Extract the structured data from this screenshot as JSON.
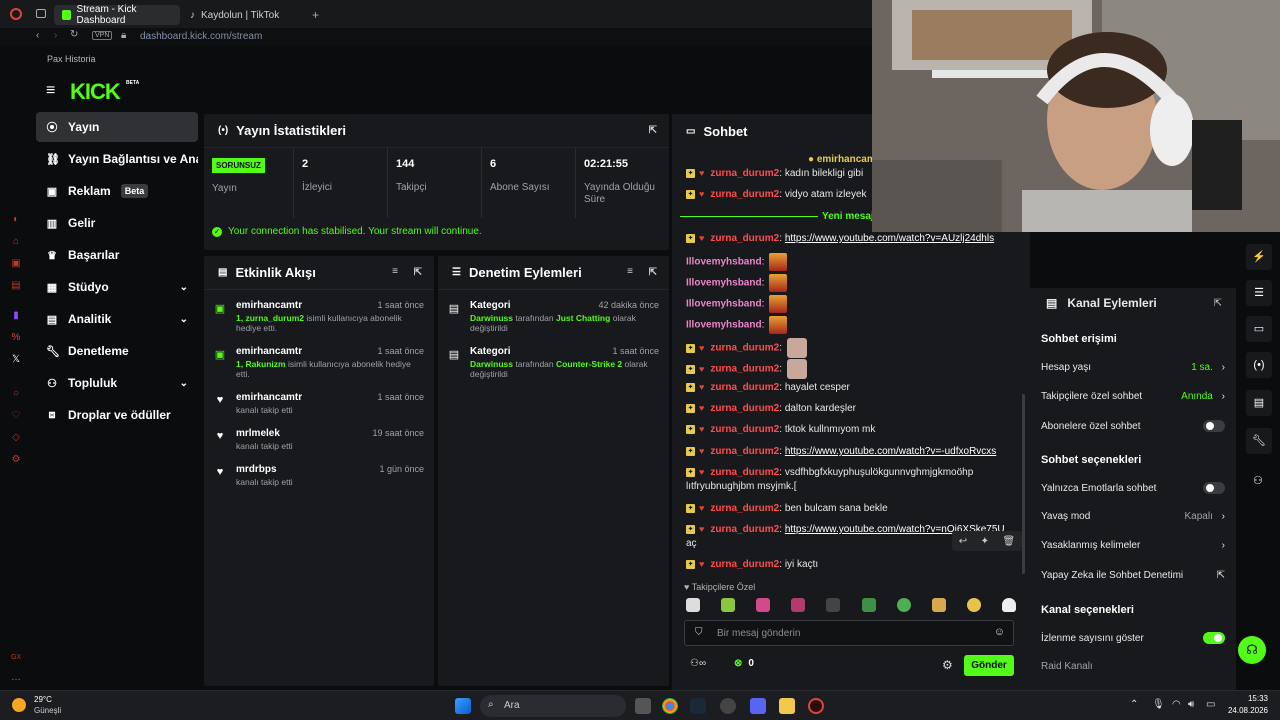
{
  "browser": {
    "tabs": [
      {
        "label": "Stream - Kick Dashboard",
        "active": true
      },
      {
        "label": "Kaydolun | TikTok",
        "active": false
      }
    ],
    "url_domain": "dashboard.kick.com",
    "url_path": "/stream",
    "vpn": "VPN",
    "bookmark": "Pax Historia"
  },
  "kick": {
    "logo": "KICK",
    "logo_sup": "BETA"
  },
  "sidebar": {
    "items": [
      {
        "label": "Yayın",
        "icon": "broadcast-icon",
        "active": true
      },
      {
        "label": "Yayın Bağlantısı ve Anahtar",
        "icon": "link-icon"
      },
      {
        "label": "Reklam",
        "icon": "ad-icon",
        "badge": "Beta"
      },
      {
        "label": "Gelir",
        "icon": "revenue-icon"
      },
      {
        "label": "Başarılar",
        "icon": "trophy-icon"
      },
      {
        "label": "Stüdyo",
        "icon": "studio-icon",
        "expandable": true
      },
      {
        "label": "Analitik",
        "icon": "chart-icon",
        "expandable": true
      },
      {
        "label": "Denetleme",
        "icon": "wrench-icon"
      },
      {
        "label": "Topluluk",
        "icon": "people-icon",
        "expandable": true
      },
      {
        "label": "Droplar ve ödüller",
        "icon": "gift-icon"
      }
    ]
  },
  "stats": {
    "title": "Yayın İstatistikleri",
    "status_badge": "SORUNSUZ",
    "status_label": "Yayın",
    "viewers": "2",
    "viewers_label": "İzleyici",
    "followers": "144",
    "followers_label": "Takipçi",
    "subs": "6",
    "subs_label": "Abone Sayısı",
    "uptime": "02:21:55",
    "uptime_label": "Yayında Olduğu Süre",
    "notice": "Your connection has stabilised. Your stream will continue."
  },
  "activity": {
    "title": "Etkinlik Akışı",
    "rows": [
      {
        "name": "emirhancamtr",
        "time": "1 saat önce",
        "desc_hl": "1, zurna_durum2",
        "desc": " isimli kullanıcıya abonelik hediye etti.",
        "icon": "gift-icon"
      },
      {
        "name": "emirhancamtr",
        "time": "1 saat önce",
        "desc_hl": "1, Rakunizm",
        "desc": " isimli kullanıcıya abonelik hediye etti.",
        "icon": "gift-icon"
      },
      {
        "name": "emirhancamtr",
        "time": "1 saat önce",
        "desc_hl": "",
        "desc": "kanalı takip etti",
        "icon": "heart-icon"
      },
      {
        "name": "mrlmelek",
        "time": "19 saat önce",
        "desc_hl": "",
        "desc": "kanalı takip etti",
        "icon": "heart-icon"
      },
      {
        "name": "mrdrbps",
        "time": "1 gün önce",
        "desc_hl": "",
        "desc": "kanalı takip etti",
        "icon": "heart-icon"
      }
    ]
  },
  "moderation": {
    "title": "Denetim Eylemleri",
    "rows": [
      {
        "name": "Kategori",
        "time": "42 dakika önce",
        "actor": "Darwinuss",
        "mid": " tarafından ",
        "value": "Just Chatting",
        "tail": " olarak değiştirildi"
      },
      {
        "name": "Kategori",
        "time": "1 saat önce",
        "actor": "Darwinuss",
        "mid": " tarafından ",
        "value": "Counter-Strike 2",
        "tail": " olarak değiştirildi"
      }
    ]
  },
  "chat": {
    "title": "Sohbet",
    "pinned_user": "emirhancam",
    "new_messages": "Yeni mesajl",
    "messages": [
      {
        "user": "zurna_durum2",
        "text": "kadın bilekligi gibi"
      },
      {
        "user": "zurna_durum2",
        "text": "vidyo atam izleyek"
      },
      {
        "user": "zurna_durum2",
        "text": "https://www.youtube.com/watch?v=AUzlj24dhls",
        "link": true
      },
      {
        "user": "Illovemyhsband",
        "text": "",
        "emote": "fire"
      },
      {
        "user": "Illovemyhsband",
        "text": "",
        "emote": "fire"
      },
      {
        "user": "Illovemyhsband",
        "text": "",
        "emote": "fire"
      },
      {
        "user": "Illovemyhsband",
        "text": "",
        "emote": "fire"
      },
      {
        "user": "zurna_durum2",
        "text": "",
        "emote": "cat"
      },
      {
        "user": "zurna_durum2",
        "text": "",
        "emote": "cat"
      },
      {
        "user": "zurna_durum2",
        "text": "hayalet cesper"
      },
      {
        "user": "zurna_durum2",
        "text": "dalton kardeşler"
      },
      {
        "user": "zurna_durum2",
        "text": "tktok kullnmıyom mk"
      },
      {
        "user": "zurna_durum2",
        "text": "https://www.youtube.com/watch?v=-udfxoRvcxs",
        "link": true
      },
      {
        "user": "zurna_durum2",
        "text": "vsdfhbgfxkuyphuşulökgunnvghmjgkmoöhp"
      },
      {
        "user": "",
        "text": "lıtfryubnughjbm msyjmk.["
      },
      {
        "user": "zurna_durum2",
        "text": "ben bulcam sana bekle"
      },
      {
        "user": "zurna_durum2",
        "text": "https://www.youtube.com/watch?v=nOi6XSke75U",
        "link": true
      },
      {
        "user": "",
        "text": "aç"
      },
      {
        "user": "zurna_durum2",
        "text": "iyi kaçtı"
      }
    ],
    "followers_only": "Takipçilere Özel",
    "input_placeholder": "Bir mesaj gönderin",
    "points": "0",
    "send": "Gönder"
  },
  "channel_actions": {
    "title": "Kanal Eylemleri",
    "sec1": "Sohbet erişimi",
    "account_age": "Hesap yaşı",
    "account_age_val": "1 sa.",
    "followers_chat": "Takipçilere özel sohbet",
    "followers_chat_val": "Anında",
    "subs_chat": "Abonelere özel sohbet",
    "sec2": "Sohbet seçenekleri",
    "emote_only": "Yalnızca Emotlarla sohbet",
    "slow_mode": "Yavaş mod",
    "slow_mode_val": "Kapalı",
    "banned_words": "Yasaklanmış kelimeler",
    "ai_mod": "Yapay Zeka ile Sohbet Denetimi",
    "sec3": "Kanal seçenekleri",
    "show_viewers": "İzlenme sayısını göster",
    "raid": "Raid Kanalı"
  },
  "taskbar": {
    "weather_temp": "29°C",
    "weather_label": "Güneşli",
    "search": "Ara",
    "time": "15:33",
    "date": "24.08.2026"
  },
  "colors": {
    "accent": "#53fc18",
    "panel": "#18191c",
    "bg": "#0b0c0d"
  }
}
